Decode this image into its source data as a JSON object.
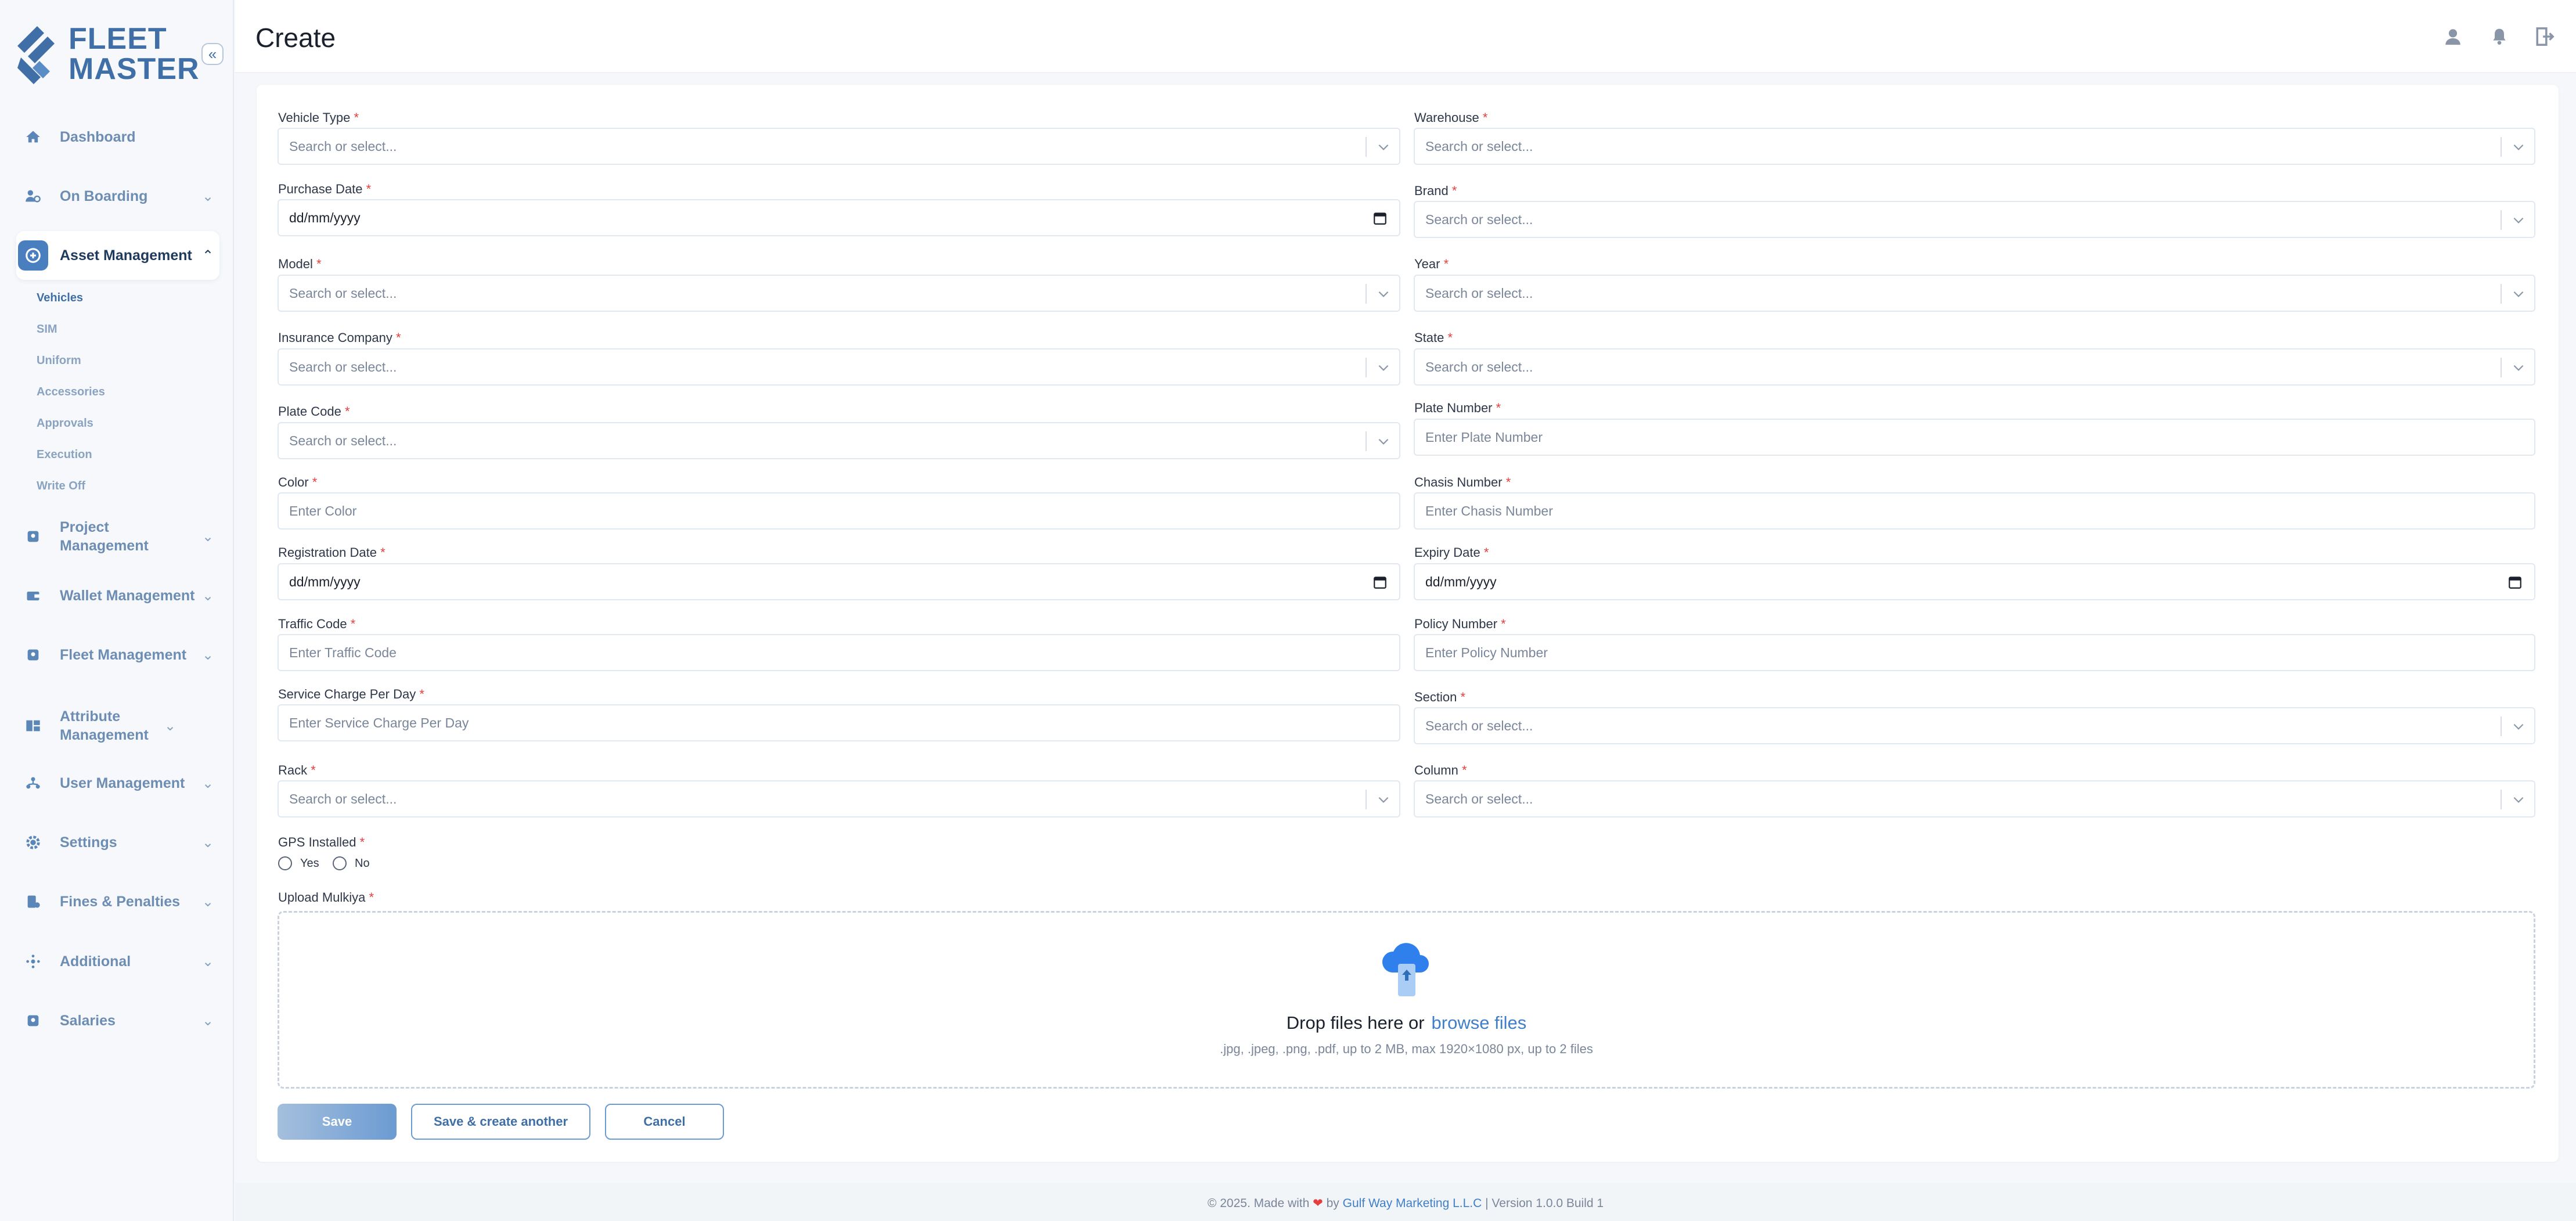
{
  "app": {
    "logo_line1": "FLEET",
    "logo_line2": "MASTER",
    "collapse_glyph": "«"
  },
  "sidebar": {
    "items": [
      {
        "label": "Dashboard",
        "icon": "home-icon"
      },
      {
        "label": "On Boarding",
        "icon": "onboarding-icon"
      },
      {
        "label": "Asset Management",
        "icon": "asset-icon"
      },
      {
        "label": "Project Management",
        "icon": "project-icon"
      },
      {
        "label": "Wallet Management",
        "icon": "wallet-icon"
      },
      {
        "label": "Fleet Management",
        "icon": "fleet-icon"
      },
      {
        "label": "Attribute Management",
        "icon": "attribute-icon"
      },
      {
        "label": "User Management",
        "icon": "users-icon"
      },
      {
        "label": "Settings",
        "icon": "gear-icon"
      },
      {
        "label": "Fines & Penalties",
        "icon": "fines-icon"
      },
      {
        "label": "Additional",
        "icon": "additional-icon"
      },
      {
        "label": "Salaries",
        "icon": "salaries-icon"
      }
    ],
    "sub_items": [
      "Vehicles",
      "SIM",
      "Uniform",
      "Accessories",
      "Approvals",
      "Execution",
      "Write Off"
    ]
  },
  "header": {
    "title": "Create"
  },
  "form": {
    "required_mark": "*",
    "select_placeholder": "Search or select...",
    "date_placeholder": "dd/mm/yyyy",
    "fields": {
      "vehicle_type": "Vehicle Type",
      "warehouse": "Warehouse",
      "purchase_date": "Purchase Date",
      "brand": "Brand",
      "model": "Model",
      "year": "Year",
      "insurance_company": "Insurance Company",
      "state": "State",
      "plate_code": "Plate Code",
      "plate_number": "Plate Number",
      "color": "Color",
      "chasis_number": "Chasis Number",
      "registration_date": "Registration Date",
      "expiry_date": "Expiry Date",
      "traffic_code": "Traffic Code",
      "policy_number": "Policy Number",
      "service_charge": "Service Charge Per Day",
      "section": "Section",
      "rack": "Rack",
      "column": "Column",
      "gps_installed": "GPS Installed",
      "upload_mulkiya": "Upload Mulkiya"
    },
    "placeholders": {
      "plate_number": "Enter Plate Number",
      "color": "Enter Color",
      "chasis_number": "Enter Chasis Number",
      "traffic_code": "Enter Traffic Code",
      "policy_number": "Enter Policy Number",
      "service_charge": "Enter Service Charge Per Day"
    },
    "gps_options": [
      "Yes",
      "No"
    ],
    "upload": {
      "drop_text": "Drop files here or",
      "browse_text": "browse files",
      "hint": ".jpg, .jpeg, .png, .pdf, up to 2 MB, max 1920×1080 px, up to 2 files"
    },
    "buttons": {
      "save": "Save",
      "save_another": "Save & create another",
      "cancel": "Cancel"
    }
  },
  "footer": {
    "prefix": "© 2025. Made with",
    "heart": "❤",
    "by": "by",
    "company": "Gulf Way Marketing L.L.C",
    "suffix": "| Version 1.0.0 Build 1"
  },
  "colors": {
    "accent": "#3f7fc7",
    "brand": "#3f6fa6",
    "required": "#e53e3e"
  }
}
